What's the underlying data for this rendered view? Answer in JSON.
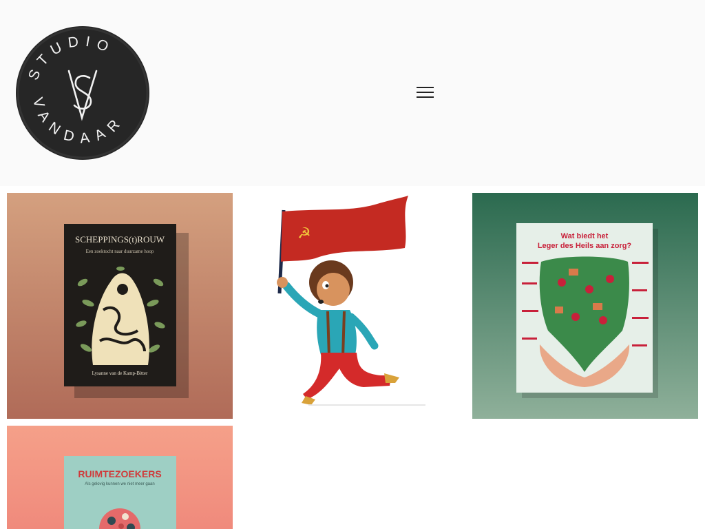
{
  "header": {
    "logo": {
      "text_top": "STUDIO",
      "text_bottom": "VANDAAR",
      "monogram": "SV",
      "icon": "studio-vandaar-logo"
    },
    "menu_icon": "hamburger-menu-icon"
  },
  "portfolio": {
    "items": [
      {
        "kind": "book-cover",
        "title": "SCHEPPINGS(t)ROUW",
        "subtitle": "Een zoektocht naar duurzame hoop",
        "author": "Lysanne van de Kamp-Bitter",
        "colors": {
          "background": "#c98b6c",
          "cover": "#1f1c19",
          "accent": "#7a9a5a"
        }
      },
      {
        "kind": "illustration",
        "description_icon": "boy-with-red-flag-illustration",
        "colors": {
          "flag": "#c42a22",
          "shirt": "#2aa6b6",
          "pants": "#d42a2a"
        }
      },
      {
        "kind": "poster",
        "title_line1": "Wat biedt het",
        "title_line2": "Leger des Heils aan zorg?",
        "colors": {
          "background": "#2f6e52",
          "poster": "#e6efe8",
          "title": "#c8213a"
        }
      },
      {
        "kind": "book-cover",
        "title": "RUIMTEZOEKERS",
        "subtitle": "Als gelovig kunnen we niet meer gaan",
        "colors": {
          "background": "#f39a86",
          "cover": "#9ecfc4",
          "title": "#d03a3a"
        }
      }
    ]
  }
}
